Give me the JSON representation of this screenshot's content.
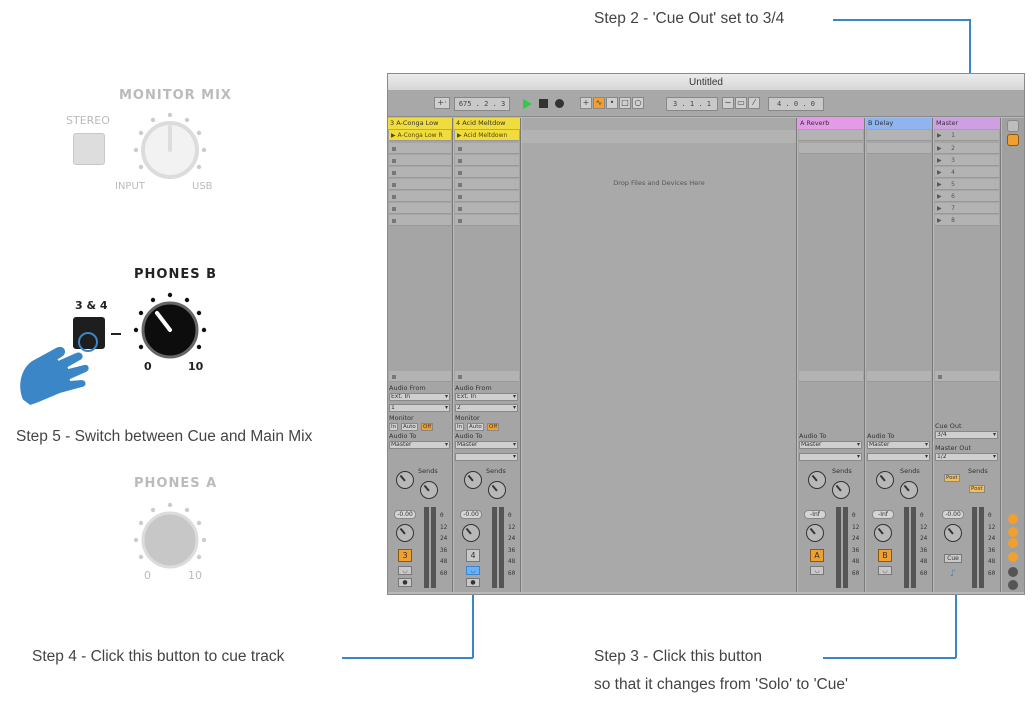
{
  "steps": {
    "step2": "Step 2 - 'Cue Out' set to 3/4",
    "step5": "Step 5 - Switch between Cue and Main Mix",
    "step4": "Step 4 - Click this button to cue track",
    "step3_line1": "Step 3 - Click this button",
    "step3_line2": "so that it changes from 'Solo' to 'Cue'"
  },
  "hardware": {
    "monitor_mix": "MONITOR MIX",
    "stereo": "STEREO",
    "input": "INPUT",
    "usb": "USB",
    "phones_b": "PHONES B",
    "phones_b_button": "3 & 4",
    "phones_b_min": "0",
    "phones_b_max": "10",
    "phones_a": "PHONES A",
    "phones_a_min": "0",
    "phones_a_max": "10"
  },
  "ableton": {
    "title": "Untitled",
    "toolbar": {
      "tempo": "675 . 2 . 3",
      "position": "3 . 1 . 1",
      "loop_length": "4 . 0 . 0"
    },
    "drop_text": "Drop Files and Devices Here",
    "tracks": [
      {
        "name": "3 A-Conga Low",
        "clip": "A-Conga Low R",
        "audio_from_label": "Audio From",
        "audio_from": "Ext. In",
        "channel": "1",
        "monitor_label": "Monitor",
        "monitor_in": "In",
        "monitor_auto": "Auto",
        "monitor_off": "Off",
        "audio_to_label": "Audio To",
        "audio_to": "Master",
        "sends_label": "Sends",
        "volume": "-0.00",
        "number": "3"
      },
      {
        "name": "4 Acid Meltdow",
        "clip": "Acid Meltdown",
        "audio_from_label": "Audio From",
        "audio_from": "Ext. In",
        "channel": "2",
        "monitor_label": "Monitor",
        "monitor_in": "In",
        "monitor_auto": "Auto",
        "monitor_off": "Off",
        "audio_to_label": "Audio To",
        "audio_to": "Master",
        "sends_label": "Sends",
        "volume": "-0.00",
        "number": "4"
      }
    ],
    "returns": [
      {
        "name": "A Reverb",
        "audio_to_label": "Audio To",
        "audio_to": "Master",
        "sends_label": "Sends",
        "volume": "-Inf",
        "letter": "A"
      },
      {
        "name": "B Delay",
        "audio_to_label": "Audio To",
        "audio_to": "Master",
        "sends_label": "Sends",
        "volume": "-Inf",
        "letter": "B"
      }
    ],
    "master": {
      "name": "Master",
      "scenes": [
        "1",
        "2",
        "3",
        "4",
        "5",
        "6",
        "7",
        "8"
      ],
      "cue_out_label": "Cue Out",
      "cue_out": "3/4",
      "master_out_label": "Master Out",
      "master_out": "1/2",
      "sends_label": "Sends",
      "post1": "Post",
      "post2": "Post",
      "volume": "-0.00",
      "cue_button": "Cue"
    },
    "db_scale": "0\n12\n24\n36\n48\n60",
    "knob_a": "A",
    "knob_b": "B"
  },
  "colors": {
    "callout": "#3b86c6",
    "track_yellow": "#f0dc3c",
    "return_a": "#e39be8",
    "return_b": "#8fb4f0",
    "master": "#cf9fe3",
    "active_orange": "#f0a030"
  }
}
